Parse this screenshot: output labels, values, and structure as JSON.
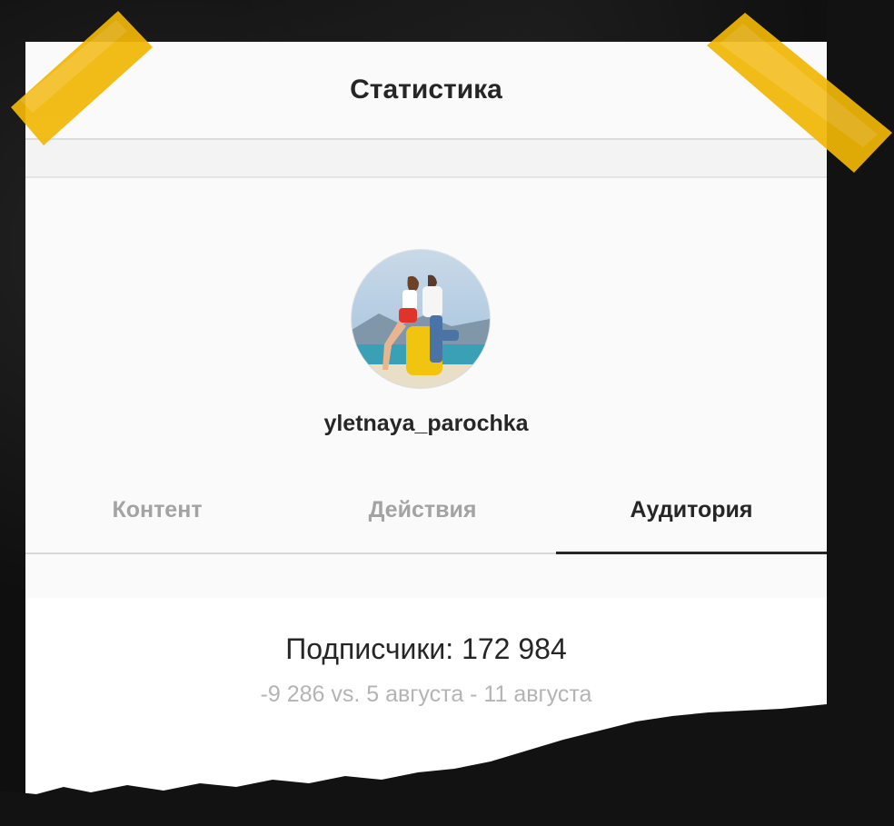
{
  "header": {
    "title": "Статистика"
  },
  "profile": {
    "avatar_icon": "profile-photo",
    "username": "yletnaya_parochka"
  },
  "tabs": [
    {
      "label": "Контент",
      "active": false
    },
    {
      "label": "Действия",
      "active": false
    },
    {
      "label": "Аудитория",
      "active": true
    }
  ],
  "audience": {
    "followers_line": "Подписчики: 172 984",
    "delta_line": "-9 286 vs. 5 августа - 11 августа"
  },
  "colors": {
    "tape": "#f2b705",
    "text_dark": "#262626",
    "text_muted": "#a3a3a3",
    "background": "#111111"
  }
}
